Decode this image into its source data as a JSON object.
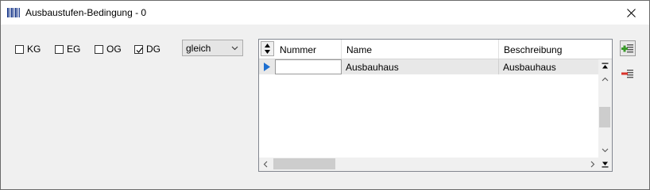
{
  "window": {
    "title": "Ausbaustufen-Bedingung - 0"
  },
  "checkboxes": [
    {
      "label": "KG",
      "checked": false
    },
    {
      "label": "EG",
      "checked": false
    },
    {
      "label": "OG",
      "checked": false
    },
    {
      "label": "DG",
      "checked": true
    }
  ],
  "combo": {
    "value": "gleich"
  },
  "grid": {
    "columns": [
      "Nummer",
      "Name",
      "Beschreibung"
    ],
    "rows": [
      {
        "nummer": "",
        "name": "Ausbauhaus",
        "beschreibung": "Ausbauhaus",
        "selected": true
      }
    ]
  },
  "icons": {
    "app": "barcode-icon",
    "close": "close-icon",
    "add": "add-row-icon",
    "remove": "remove-row-icon",
    "sort": "sort-icon",
    "row_indicator": "current-row-arrow-icon"
  },
  "colors": {
    "accent_blue": "#1e6fd0",
    "add_green": "#3a9a2a",
    "remove_red": "#d9342b"
  }
}
